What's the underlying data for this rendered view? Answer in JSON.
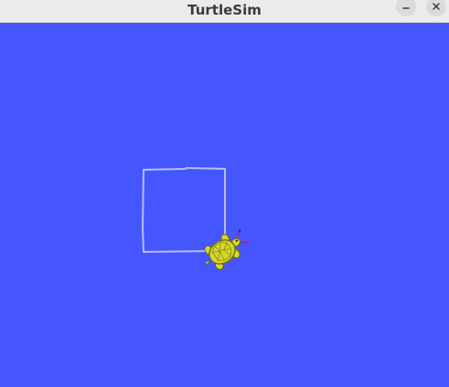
{
  "window": {
    "title": "TurtleSim",
    "colors": {
      "titlebar": "#ebebeb",
      "title_text": "#3b3b3b",
      "canvas_background": "#4556ff",
      "trail": "#b8bcff",
      "turtle_shell": "#d6d82b",
      "turtle_outline": "#6f6c12"
    },
    "controls": {
      "minimize_icon": "minimize-icon",
      "close_icon": "close-icon"
    }
  }
}
